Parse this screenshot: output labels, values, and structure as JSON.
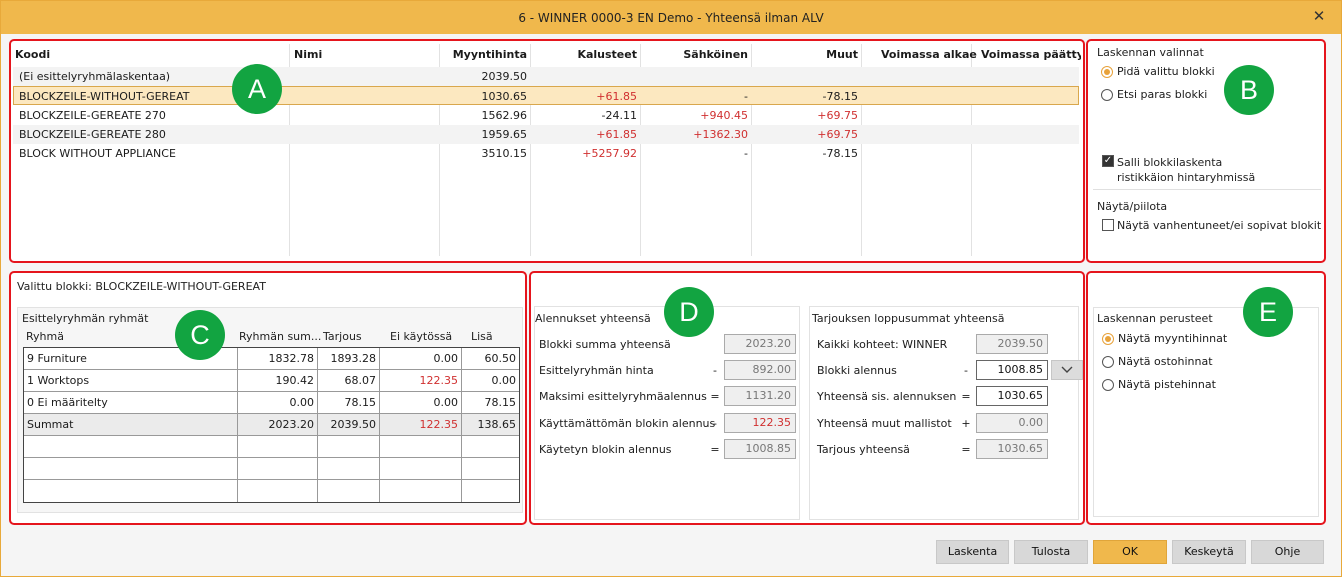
{
  "window": {
    "title": "6 - WINNER 0000-3 EN Demo - Yhteensä ilman ALV",
    "close_icon": "close-icon"
  },
  "badges": {
    "a": "A",
    "b": "B",
    "c": "C",
    "d": "D",
    "e": "E"
  },
  "grid": {
    "columns": [
      "Koodi",
      "Nimi",
      "Myyntihinta",
      "Kalusteet",
      "Sähköinen",
      "Muut",
      "Voimassa alkaen",
      "Voimassa päättyen"
    ],
    "rows": [
      {
        "koodi": "(Ei esittelyryhmälaskentaa)",
        "nimi": "",
        "myyntihinta": "2039.50",
        "kalusteet": "",
        "sahkoinen": "",
        "muut": ""
      },
      {
        "koodi": "BLOCKZEILE-WITHOUT-GEREAT",
        "nimi": "",
        "myyntihinta": "1030.65",
        "kalusteet": "+61.85",
        "sahkoinen": "-",
        "muut": "-78.15"
      },
      {
        "koodi": "BLOCKZEILE-GEREATE 270",
        "nimi": "",
        "myyntihinta": "1562.96",
        "kalusteet": "-24.11",
        "sahkoinen": "+940.45",
        "muut": "+69.75"
      },
      {
        "koodi": "BLOCKZEILE-GEREATE 280",
        "nimi": "",
        "myyntihinta": "1959.65",
        "kalusteet": "+61.85",
        "sahkoinen": "+1362.30",
        "muut": "+69.75"
      },
      {
        "koodi": "BLOCK WITHOUT APPLIANCE",
        "nimi": "",
        "myyntihinta": "3510.15",
        "kalusteet": "+5257.92",
        "sahkoinen": "-",
        "muut": "-78.15"
      }
    ]
  },
  "calc_options": {
    "title": "Laskennan valinnat",
    "keep_block": "Pidä valittu blokki",
    "find_best": "Etsi paras blokki",
    "allow_grid_line1": "Salli blokkilaskenta",
    "allow_grid_line2": "ristikkäion hintaryhmissä",
    "show_hide_title": "Näytä/piilota",
    "show_expired": "Näytä vanhentuneet/ei sopivat blokit"
  },
  "selected_block": {
    "label": "Valittu blokki: BLOCKZEILE-WITHOUT-GEREAT",
    "groups_title": "Esittelyryhmän ryhmät",
    "headers": [
      "Ryhmä",
      "Ryhmän sum...",
      "Tarjous",
      "Ei käytössä",
      "Lisä"
    ],
    "rows": [
      {
        "ryhma": "9 Furniture",
        "summa": "1832.78",
        "tarjous": "1893.28",
        "ei": "0.00",
        "lisa": "60.50"
      },
      {
        "ryhma": "1 Worktops",
        "summa": "190.42",
        "tarjous": "68.07",
        "ei": "122.35",
        "lisa": "0.00"
      },
      {
        "ryhma": "0 Ei määritelty",
        "summa": "0.00",
        "tarjous": "78.15",
        "ei": "0.00",
        "lisa": "78.15"
      },
      {
        "ryhma": "Summat",
        "summa": "2023.20",
        "tarjous": "2039.50",
        "ei": "122.35",
        "lisa": "138.65"
      }
    ]
  },
  "discounts": {
    "title": "Alennukset yhteensä",
    "rows": [
      {
        "label": "Blokki summa yhteensä",
        "op": "",
        "value": "2023.20"
      },
      {
        "label": "Esittelyryhmän hinta",
        "op": "-",
        "value": "892.00"
      },
      {
        "label": "Maksimi esittelyryhmäalennus",
        "op": "=",
        "value": "1131.20"
      },
      {
        "label": "Käyttämättömän blokin alennus",
        "op": "-",
        "value": "122.35"
      },
      {
        "label": "Käytetyn blokin alennus",
        "op": "=",
        "value": "1008.85"
      }
    ]
  },
  "totals": {
    "title": "Tarjouksen loppusummat yhteensä",
    "rows": [
      {
        "label": "Kaikki kohteet: WINNER",
        "op": "",
        "value": "2039.50"
      },
      {
        "label": "Blokki alennus",
        "op": "-",
        "value": "1008.85"
      },
      {
        "label": "Yhteensä sis. alennuksen",
        "op": "=",
        "value": "1030.65"
      },
      {
        "label": "Yhteensä muut mallistot",
        "op": "+",
        "value": "0.00"
      },
      {
        "label": "Tarjous yhteensä",
        "op": "=",
        "value": "1030.65"
      }
    ]
  },
  "calc_basis": {
    "title": "Laskennan perusteet",
    "options": [
      "Näytä myyntihinnat",
      "Näytä ostohinnat",
      "Näytä pistehinnat"
    ]
  },
  "buttons": {
    "laskenta": "Laskenta",
    "tulosta": "Tulosta",
    "ok": "OK",
    "keskeyta": "Keskeytä",
    "ohje": "Ohje"
  },
  "colors": {
    "titlebar": "#f0b84c",
    "panel_border": "#e5151d",
    "badge": "#12a441",
    "negative_text": "#d03030"
  }
}
